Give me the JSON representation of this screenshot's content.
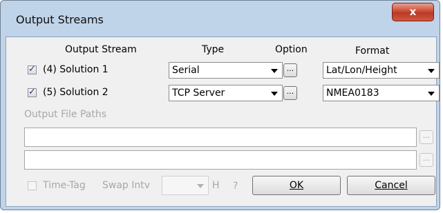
{
  "window": {
    "title": "Output Streams",
    "close_glyph": "x"
  },
  "headers": {
    "stream": "Output Stream",
    "type": "Type",
    "option": "Option",
    "format": "Format"
  },
  "streams": [
    {
      "checked": true,
      "label": "(4) Solution 1",
      "type": "Serial",
      "format": "Lat/Lon/Height",
      "option_label": "..."
    },
    {
      "checked": true,
      "label": "(5) Solution 2",
      "type": "TCP Server",
      "format": "NMEA0183",
      "option_label": "..."
    }
  ],
  "file_paths": {
    "label": "Output File Paths",
    "path1": "",
    "path2": "",
    "browse_label": "..."
  },
  "footer": {
    "time_tag_label": "Time-Tag",
    "time_tag_checked": false,
    "swap_label": "Swap Intv",
    "swap_value": "",
    "swap_unit": "H",
    "help": "?",
    "ok_label": "OK",
    "cancel_label": "Cancel"
  }
}
